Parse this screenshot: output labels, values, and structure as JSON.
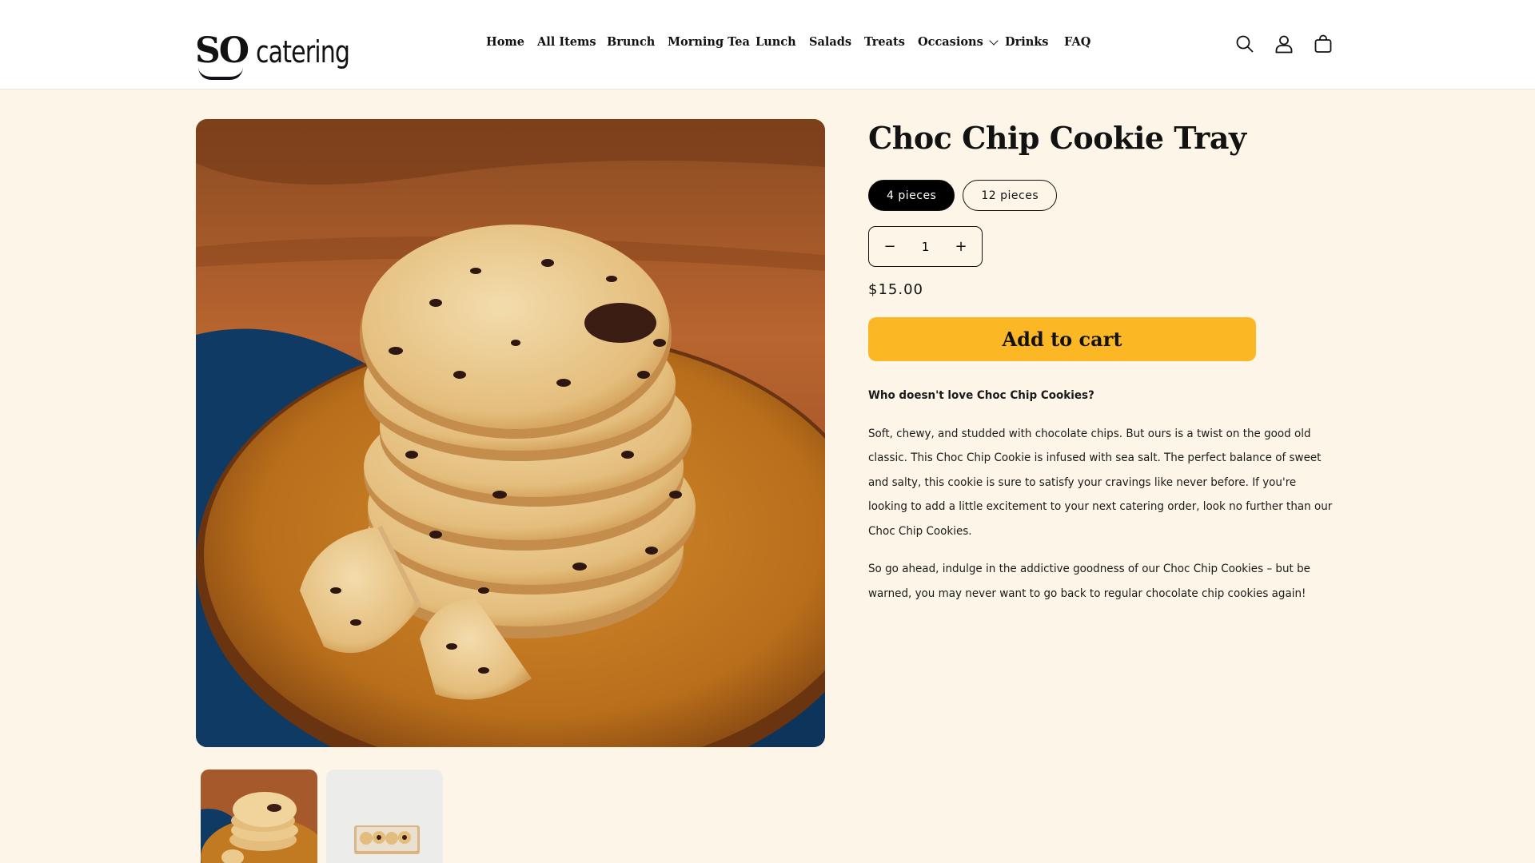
{
  "brand": {
    "logo_mark": "SO",
    "logo_word": "catering"
  },
  "nav": {
    "items": [
      {
        "label": "Home"
      },
      {
        "label": "All Items"
      },
      {
        "label": "Brunch"
      },
      {
        "label": "Morning Tea"
      },
      {
        "label": "Lunch"
      },
      {
        "label": "Salads"
      },
      {
        "label": "Treats"
      },
      {
        "label": "Occasions",
        "has_dropdown": true
      },
      {
        "label": "Drinks"
      },
      {
        "label": "FAQ"
      }
    ]
  },
  "header_icons": [
    "search-icon",
    "account-icon",
    "cart-icon"
  ],
  "product": {
    "title": "Choc Chip Cookie Tray",
    "variants": [
      {
        "label": "4 pieces",
        "selected": true
      },
      {
        "label": "12 pieces",
        "selected": false
      }
    ],
    "quantity": {
      "minus": "−",
      "value": "1",
      "plus": "+"
    },
    "price": "$15.00",
    "add_to_cart": "Add to cart",
    "description": {
      "heading": "Who doesn't love Choc Chip Cookies?",
      "paragraphs": [
        "Soft, chewy, and studded with chocolate chips. But ours is a twist on the good old classic. This Choc Chip Cookie is infused with sea salt. The perfect balance of sweet and salty, this cookie is sure to satisfy your cravings like never before. If you're looking to add a little excitement to your next catering order, look no further than our Choc Chip Cookies.",
        "So go ahead, indulge in the addictive goodness of our Choc Chip Cookies – but be warned, you may never want to go back to regular chocolate chip cookies again!"
      ]
    }
  },
  "colors": {
    "page_bg": "#fdf6e8",
    "header_bg": "#ffffff",
    "accent": "#fbb824",
    "text": "#121212"
  }
}
